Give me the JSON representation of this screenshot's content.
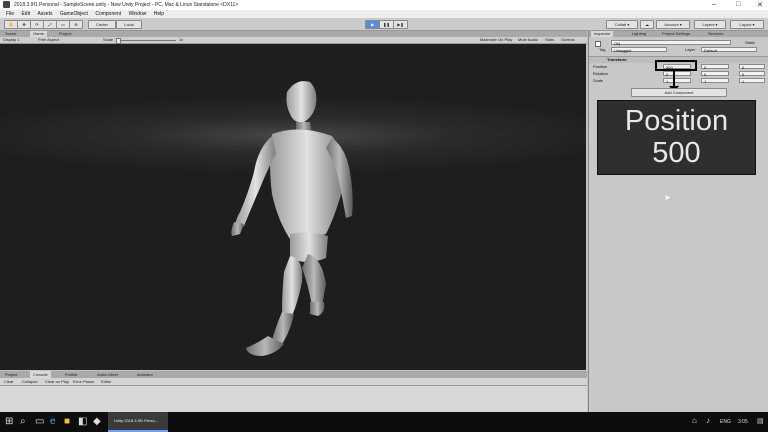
{
  "window": {
    "title": "2018.3.9f1 Personal - SampleScene.unity - New Unity Project - PC, Mac & Linux Standalone <DX11>",
    "controls": [
      "–",
      "□",
      "✕"
    ]
  },
  "menu": [
    "File",
    "Edit",
    "Assets",
    "GameObject",
    "Component",
    "Window",
    "Help"
  ],
  "toolbar": {
    "center": "Center",
    "local": "Local",
    "collab": "Collab ▾",
    "account": "Account ▾",
    "layers": "Layers ▾",
    "layout": "Layout ▾"
  },
  "scene_tabs": [
    "Scene",
    "Game",
    "Project"
  ],
  "game_bar": {
    "display": "Display 1",
    "aspect": "Free Aspect",
    "scale_label": "Scale",
    "scale_value": "1x",
    "options": [
      "Maximize On Play",
      "Mute Audio",
      "Stats",
      "Gizmos"
    ]
  },
  "console": {
    "tabs": [
      "Project",
      "Console",
      "Profiler",
      "Audio Mixer",
      "Animator"
    ],
    "buttons": [
      "Clear",
      "Collapse",
      "Clear on Play",
      "Error Pause",
      "Editor"
    ]
  },
  "inspector": {
    "tabs": [
      "Inspector",
      "Lighting",
      "Project Settings",
      "Services"
    ],
    "object_name": "Obj",
    "static_label": "Static",
    "tag_label": "Tag",
    "tag_value": "Untagged",
    "layer_label": "Layer",
    "layer_value": "Default",
    "component": "Transform",
    "rows": [
      {
        "label": "Position",
        "x": "500",
        "y": "0",
        "z": "0"
      },
      {
        "label": "Rotation",
        "x": "0",
        "y": "0",
        "z": "0"
      },
      {
        "label": "Scale",
        "x": "1",
        "y": "1",
        "z": "1"
      }
    ],
    "add_component": "Add Component"
  },
  "callout": {
    "line1": "Position",
    "line2": "500"
  },
  "taskbar": {
    "app_item": "Unity 2018.3.9f1 Perso...",
    "lang": "ENG",
    "time": "3:05"
  },
  "colors": {
    "highlight": "#000000",
    "viewport": "#1e1e1e"
  }
}
